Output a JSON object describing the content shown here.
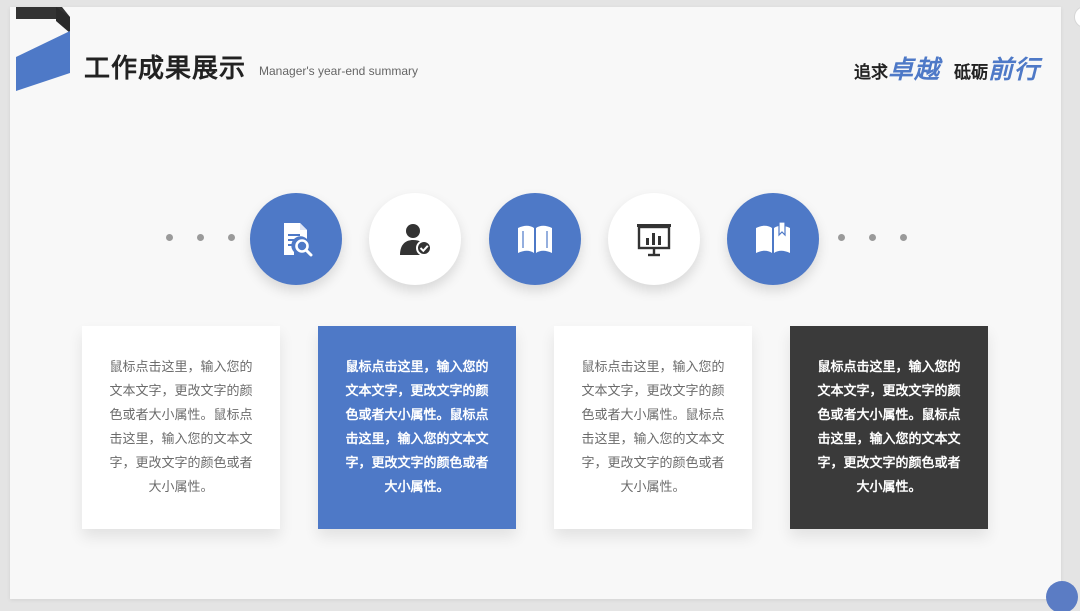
{
  "header": {
    "title": "工作成果展示",
    "subtitle": "Manager's year-end summary",
    "slogan": {
      "part1": "追求",
      "part1_highlight": "卓越",
      "part2": "砥砺",
      "part2_highlight": "前行"
    }
  },
  "icons": [
    {
      "name": "document-search-icon",
      "style": "blue"
    },
    {
      "name": "user-check-icon",
      "style": "white"
    },
    {
      "name": "open-book-icon",
      "style": "blue"
    },
    {
      "name": "presentation-chart-icon",
      "style": "white"
    },
    {
      "name": "bookmark-book-icon",
      "style": "blue"
    }
  ],
  "cards": [
    {
      "text": "鼠标点击这里，输入您的文本文字，更改文字的颜色或者大小属性。鼠标点击这里，输入您的文本文字，更改文字的颜色或者大小属性。",
      "style": "white"
    },
    {
      "text": "鼠标点击这里，输入您的文本文字，更改文字的颜色或者大小属性。鼠标点击这里，输入您的文本文字，更改文字的颜色或者大小属性。",
      "style": "blue"
    },
    {
      "text": "鼠标点击这里，输入您的文本文字，更改文字的颜色或者大小属性。鼠标点击这里，输入您的文本文字，更改文字的颜色或者大小属性。",
      "style": "white"
    },
    {
      "text": "鼠标点击这里，输入您的文本文字，更改文字的颜色或者大小属性。鼠标点击这里，输入您的文本文字，更改文字的颜色或者大小属性。",
      "style": "dark"
    }
  ],
  "colors": {
    "accent": "#4e79c7",
    "dark": "#3a3a3a",
    "background": "#f8f8f8"
  }
}
